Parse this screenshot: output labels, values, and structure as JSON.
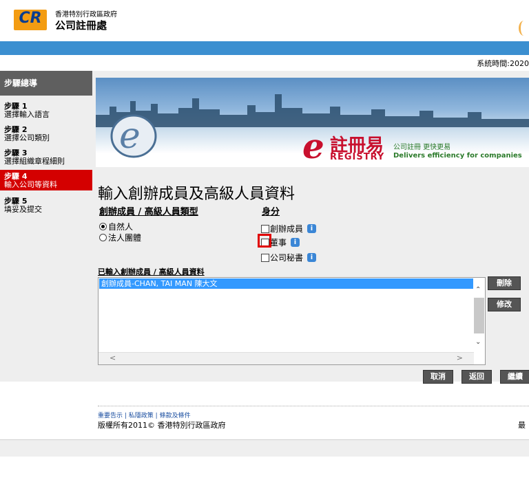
{
  "header": {
    "logo_text": "CR",
    "gov_name": "香港特別行政區政府",
    "dept_name": "公司註冊處"
  },
  "system_time": "系統時間:2020",
  "sidebar": {
    "heading": "步驟總導",
    "steps": [
      {
        "num": "步驟 1",
        "label": "選擇輸入語言"
      },
      {
        "num": "步驟 2",
        "label": "選擇公司類別"
      },
      {
        "num": "步驟 3",
        "label": "選擇組織章程細則"
      },
      {
        "num": "步驟 4",
        "label": "輸入公司等資料",
        "active": true
      },
      {
        "num": "步驟 5",
        "label": "填妥及提交"
      }
    ]
  },
  "banner": {
    "brand_zh": "註冊易",
    "brand_en": "REGISTRY",
    "slogan_zh": "公司註冊 更快更易",
    "slogan_en": "Delivers efficiency for companies"
  },
  "page_title": "輸入創辦成員及高級人員資料",
  "member_type": {
    "label": "創辦成員 / 高級人員類型",
    "options": [
      {
        "label": "自然人",
        "selected": true
      },
      {
        "label": "法人團體",
        "selected": false
      }
    ]
  },
  "identity": {
    "label": "身分",
    "options": [
      {
        "label": "創辦成員",
        "checked": false
      },
      {
        "label": "董事",
        "checked": false
      },
      {
        "label": "公司秘書",
        "checked": false
      }
    ]
  },
  "entered_list": {
    "label": "已輸入創辦成員 / 高級人員資料",
    "items": [
      "創辦成員-CHAN, TAI MAN 陳大文"
    ]
  },
  "buttons": {
    "delete": "刪除",
    "modify": "修改",
    "cancel": "取消",
    "back": "返回",
    "continue": "繼續"
  },
  "footer": {
    "links": [
      "重要告示",
      "私隱政策",
      "條款及條件"
    ],
    "copyright": "版權所有2011© 香港特別行政區政府",
    "right_text": "最"
  }
}
